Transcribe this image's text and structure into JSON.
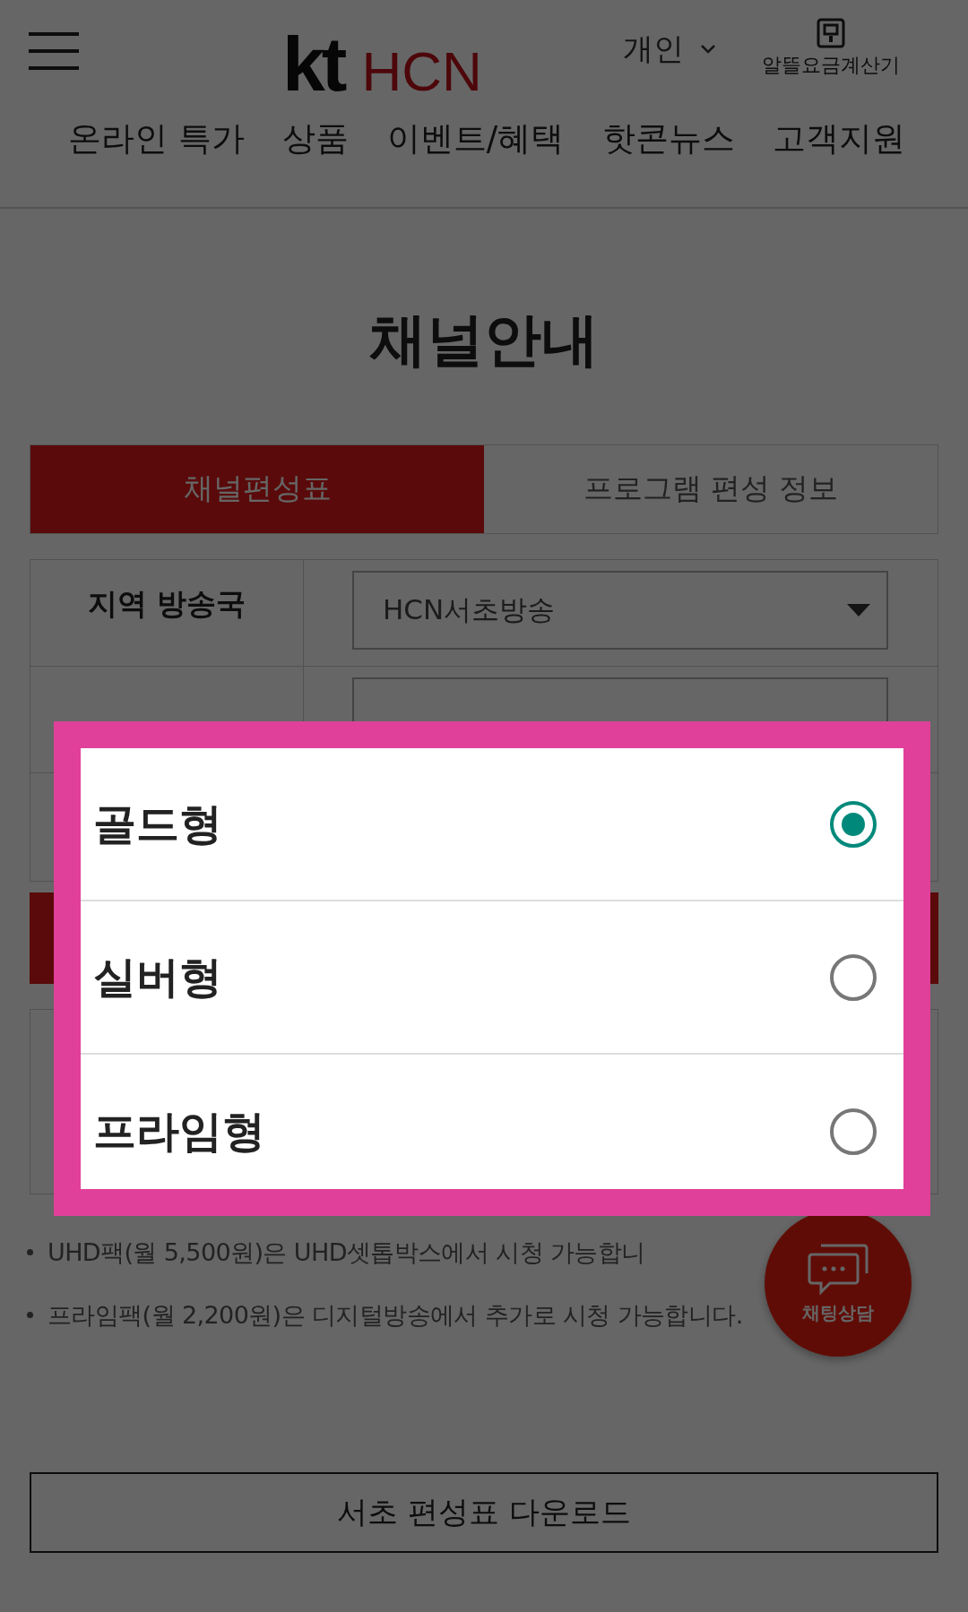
{
  "header": {
    "brand_kt": "kt",
    "brand_hcn": "HCN",
    "segment": "개인",
    "calculator": "알뜰요금계산기"
  },
  "nav": [
    "온라인 특가",
    "상품",
    "이벤트/혜택",
    "핫콘뉴스",
    "고객지원"
  ],
  "title": "채널안내",
  "tabs": [
    {
      "label": "채널편성표",
      "selected": true
    },
    {
      "label": "프로그램 편성 정보",
      "selected": false
    }
  ],
  "form": {
    "region_label": "지역 방송국",
    "region_value": "HCN서초방송"
  },
  "notes": [
    "UHD팩(월 5,500원)은 UHD셋톱박스에서 시청 가능합니",
    "프라임팩(월 2,200원)은 디지털방송에서 추가로 시청 가능합니다."
  ],
  "download_button": "서초 편성표 다운로드",
  "chat_button": "채팅상담",
  "dialog": {
    "options": [
      {
        "label": "골드형",
        "selected": true
      },
      {
        "label": "실버형",
        "selected": false
      },
      {
        "label": "프라임형",
        "selected": false
      }
    ]
  }
}
